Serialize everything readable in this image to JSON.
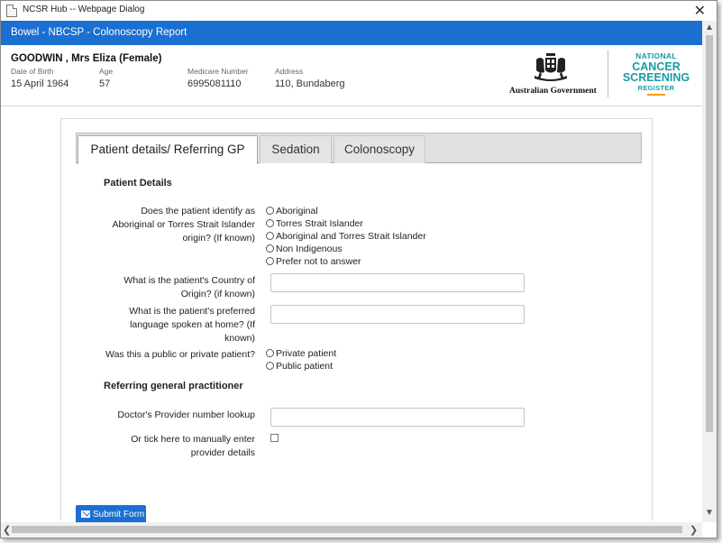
{
  "window": {
    "title": "NCSR Hub -- Webpage Dialog"
  },
  "header": {
    "title": "Bowel - NBCSP - Colonoscopy Report"
  },
  "patient": {
    "name": "GOODWIN , Mrs Eliza (Female)",
    "dob_label": "Date of Birth",
    "dob": "15 April 1964",
    "age_label": "Age",
    "age": "57",
    "medicare_label": "Medicare Number",
    "medicare": "6995081110",
    "address_label": "Address",
    "address": "110, Bundaberg"
  },
  "logos": {
    "gov": "Australian Government",
    "ncsr": {
      "line1": "NATIONAL",
      "line2": "CANCER",
      "line3": "SCREENING",
      "line4": "REGISTER"
    }
  },
  "tabs": [
    {
      "label": "Patient details/ Referring GP",
      "active": true
    },
    {
      "label": "Sedation",
      "active": false
    },
    {
      "label": "Colonoscopy",
      "active": false
    }
  ],
  "form": {
    "patient_details_title": "Patient Details",
    "indigenous_question": "Does the patient identify as Aboriginal or Torres Strait Islander origin? (If known)",
    "indigenous_options": [
      "Aboriginal",
      "Torres Strait Islander",
      "Aboriginal and Torres Strait Islander",
      "Non Indigenous",
      "Prefer not to answer"
    ],
    "country_question": "What is the patient's Country of Origin? (if known)",
    "language_question": "What is the patient's preferred language spoken at home? (If known)",
    "patient_type_question": "Was this a public or private patient?",
    "patient_type_options": [
      "Private patient",
      "Public patient"
    ],
    "referring_title": "Referring general practitioner",
    "provider_lookup_label": "Doctor's Provider number lookup",
    "manual_entry_label": "Or tick here to manually enter provider details"
  },
  "submit": {
    "label": "Submit Form"
  },
  "colors": {
    "accent": "#1a6fd1",
    "ncsr": "#1a9ba5"
  }
}
